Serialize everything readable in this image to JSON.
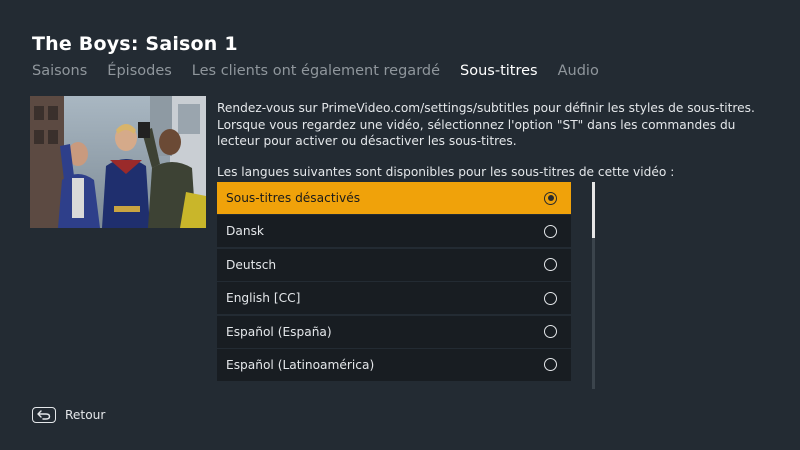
{
  "header": {
    "title": "The Boys: Saison 1"
  },
  "tabs": [
    {
      "label": "Saisons",
      "active": false
    },
    {
      "label": "Épisodes",
      "active": false
    },
    {
      "label": "Les clients ont également regardé",
      "active": false
    },
    {
      "label": "Sous-titres",
      "active": true
    },
    {
      "label": "Audio",
      "active": false
    }
  ],
  "subtitles": {
    "description": "Rendez-vous sur PrimeVideo.com/settings/subtitles pour définir les styles de sous-titres. Lorsque vous regardez une vidéo, sélectionnez l'option \"ST\" dans les commandes du lecteur pour activer ou désactiver les sous-titres.",
    "languages_intro": "Les langues suivantes sont disponibles pour les sous-titres de cette vidéo :",
    "options": [
      {
        "label": "Sous-titres désactivés",
        "selected": true
      },
      {
        "label": "Dansk",
        "selected": false
      },
      {
        "label": "Deutsch",
        "selected": false
      },
      {
        "label": "English [CC]",
        "selected": false
      },
      {
        "label": "Español (España)",
        "selected": false
      },
      {
        "label": "Español (Latinoamérica)",
        "selected": false
      }
    ]
  },
  "footer": {
    "back_label": "Retour",
    "back_icon": "back-arrow-icon"
  },
  "colors": {
    "background": "#232b33",
    "accent": "#f0a20a",
    "row_background": "#181d22"
  }
}
